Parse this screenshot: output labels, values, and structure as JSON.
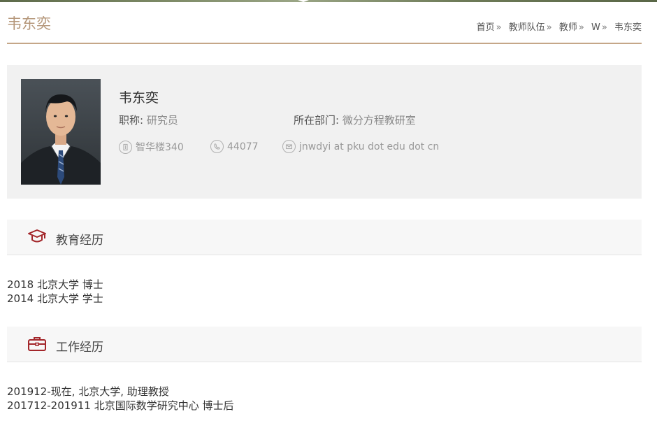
{
  "header": {
    "title": "韦东奕",
    "breadcrumb": [
      {
        "label": "首页"
      },
      {
        "label": "教师队伍"
      },
      {
        "label": "教师"
      },
      {
        "label": "W"
      },
      {
        "label": "韦东奕"
      }
    ]
  },
  "profile": {
    "name": "韦东奕",
    "title_label": "职称:",
    "title_value": "研究员",
    "dept_label": "所在部门:",
    "dept_value": "微分方程教研室",
    "office": "智华楼340",
    "phone": "44077",
    "email": "jnwdyi at pku dot edu dot cn"
  },
  "education": {
    "heading": "教育经历",
    "items": [
      "2018 北京大学 博士",
      "2014 北京大学 学士"
    ]
  },
  "work": {
    "heading": "工作经历",
    "items": [
      "201912-现在, 北京大学, 助理教授",
      "201712-201911 北京国际数学研究中心 博士后"
    ]
  },
  "colors": {
    "accent": "#b5977a",
    "header_rule": "#c5a788",
    "section_icon": "#a3262a",
    "card_bg": "#f1f1f1"
  },
  "icons": {
    "education": "graduation-cap-icon",
    "work": "briefcase-icon",
    "office": "building-icon",
    "phone": "phone-icon",
    "email": "mail-icon"
  }
}
